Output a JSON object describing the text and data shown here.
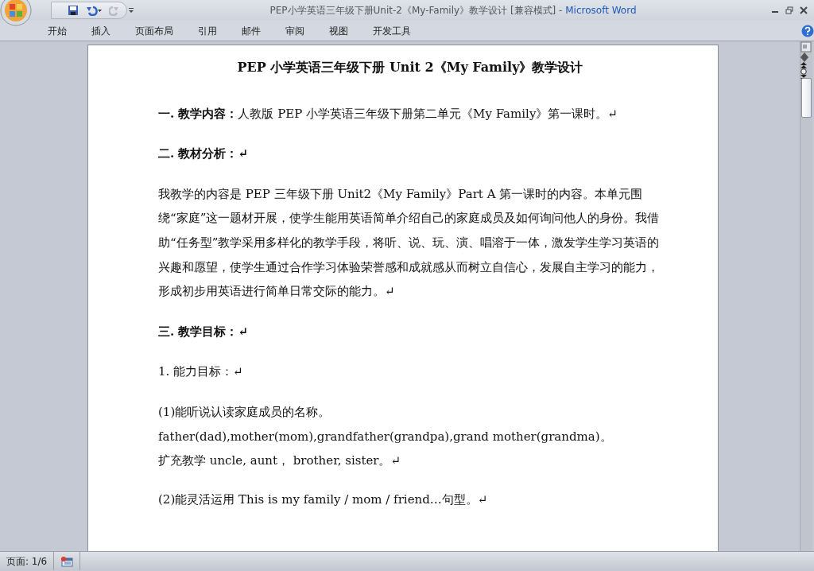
{
  "window": {
    "title": "PEP小学英语三年级下册Unit-2《My-Family》教学设计 [兼容模式]",
    "separator": "-",
    "app_name": "Microsoft Word"
  },
  "quick_access": [
    {
      "kind": "save",
      "disabled": false
    },
    {
      "kind": "undo",
      "disabled": false
    },
    {
      "kind": "redo",
      "disabled": true
    }
  ],
  "ribbon_tabs": [
    "开始",
    "插入",
    "页面布局",
    "引用",
    "邮件",
    "审阅",
    "视图",
    "开发工具"
  ],
  "document": {
    "blocks": [
      {
        "kind": "title",
        "text": "PEP 小学英语三年级下册 Unit 2《My Family》教学设计"
      },
      {
        "kind": "paragraph",
        "text": "**一. 教学内容：**人教版 PEP 小学英语三年级下册第二单元《My Family》第一课时。↵"
      },
      {
        "kind": "heading",
        "text": "二. 教材分析：↵"
      },
      {
        "kind": "paragraph",
        "text": "我教学的内容是 PEP 三年级下册 Unit2《My Family》Part A 第一课时的内容。本单元围绕“家庭”这一题材开展，使学生能用英语简单介绍自己的家庭成员及如何询问他人的身份。我借助“任务型”教学采用多样化的教学手段，将听、说、玩、演、唱溶于一体，激发学生学习英语的兴趣和愿望，使学生通过合作学习体验荣誉感和成就感从而树立自信心，发展自主学习的能力，形成初步用英语进行简单日常交际的能力。↵"
      },
      {
        "kind": "heading",
        "text": "三. 教学目标：↵"
      },
      {
        "kind": "paragraph",
        "text": "1. 能力目标：↵"
      },
      {
        "kind": "lines",
        "lines": [
          "(1)能听说认读家庭成员的名称。",
          "father(dad),mother(mom),grandfather(grandpa),grand mother(grandma)。",
          "扩充教学 uncle, aunt， brother, sister。↵"
        ]
      },
      {
        "kind": "paragraph",
        "text": "(2)能灵活运用 This is my family / mom / friend…句型。↵"
      }
    ]
  },
  "status_bar": {
    "page": "页面: 1/6"
  }
}
